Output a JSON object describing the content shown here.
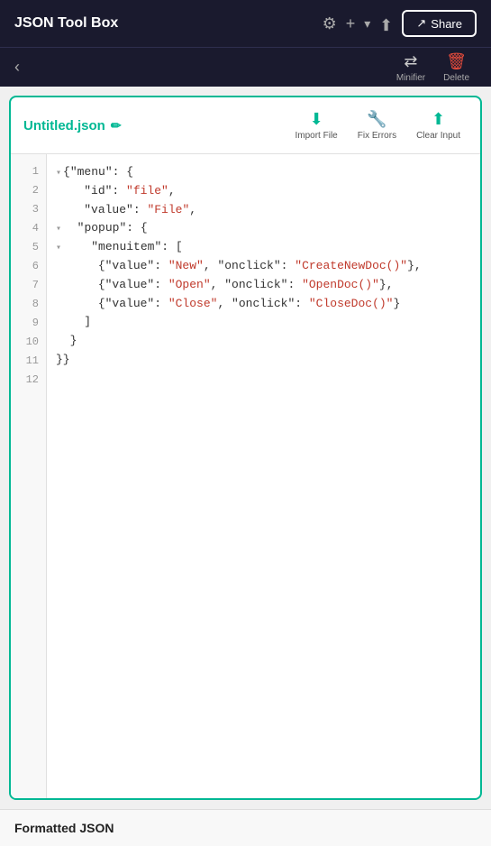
{
  "header": {
    "title": "JSON Tool Box",
    "share_label": "Share",
    "gear_icon": "⚙",
    "add_icon": "+",
    "chevron_icon": "▾",
    "import_icon": "⬆"
  },
  "toolbar2": {
    "minifier_label": "Minifier",
    "delete_label": "Delete"
  },
  "card": {
    "filename": "Untitled.json",
    "import_label": "Import File",
    "fix_label": "Fix Errors",
    "clear_label": "Clear Input"
  },
  "editor": {
    "lines": [
      1,
      2,
      3,
      4,
      5,
      6,
      7,
      8,
      9,
      10,
      11,
      12
    ]
  },
  "bottom": {
    "label": "Formatted JSON"
  }
}
